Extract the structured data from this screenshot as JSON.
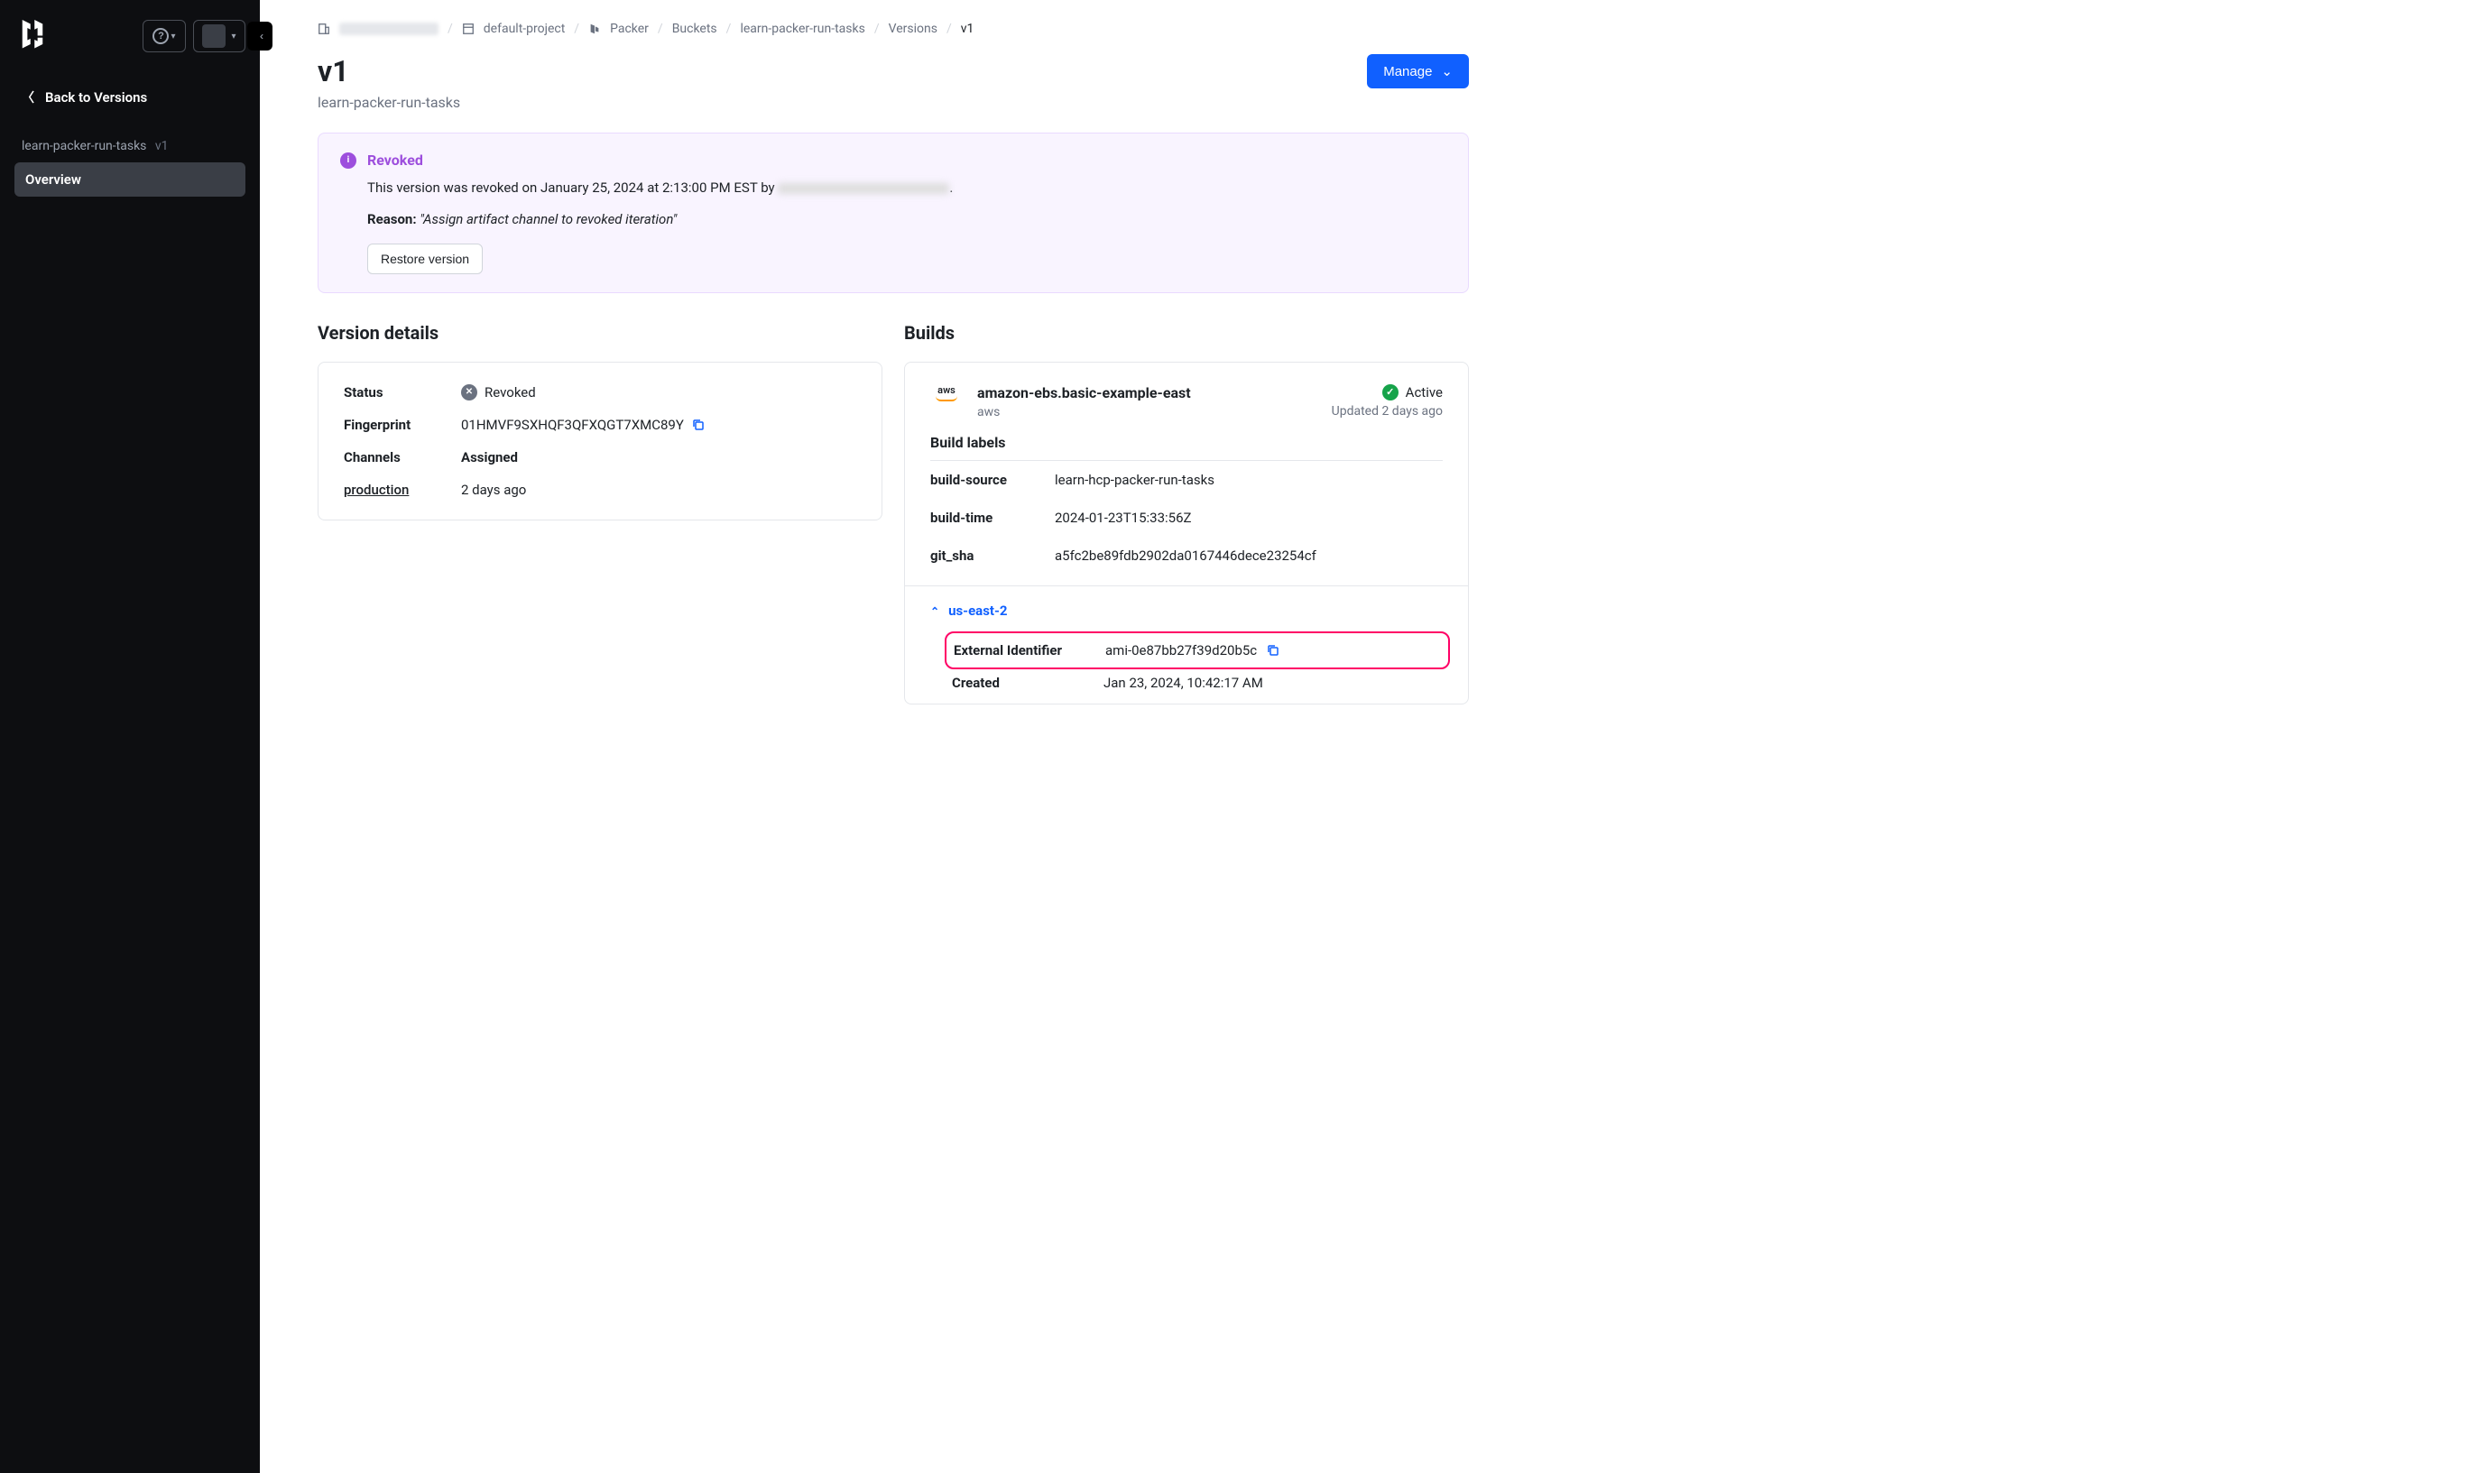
{
  "sidebar": {
    "back_label": "Back to Versions",
    "context_name": "learn-packer-run-tasks",
    "context_version": "v1",
    "items": [
      {
        "label": "Overview",
        "active": true
      }
    ]
  },
  "breadcrumb": {
    "org_redacted": true,
    "project": "default-project",
    "service": "Packer",
    "buckets": "Buckets",
    "bucket": "learn-packer-run-tasks",
    "versions": "Versions",
    "current": "v1"
  },
  "header": {
    "title": "v1",
    "subtitle": "learn-packer-run-tasks",
    "manage_label": "Manage"
  },
  "alert": {
    "title": "Revoked",
    "text_prefix": "This version was revoked on January 25, 2024 at 2:13:00 PM EST by ",
    "text_suffix": ".",
    "reason_label": "Reason:",
    "reason_text": "\"Assign artifact channel to revoked iteration\"",
    "restore_label": "Restore version"
  },
  "details": {
    "section_title": "Version details",
    "rows": {
      "status_label": "Status",
      "status_value": "Revoked",
      "fingerprint_label": "Fingerprint",
      "fingerprint_value": "01HMVF9SXHQF3QFXQGT7XMC89Y",
      "channels_label": "Channels",
      "channels_value": "Assigned",
      "production_label": "production",
      "production_value": "2 days ago"
    }
  },
  "builds": {
    "section_title": "Builds",
    "name": "amazon-ebs.basic-example-east",
    "provider": "aws",
    "status": "Active",
    "updated": "Updated 2 days ago",
    "labels_title": "Build labels",
    "labels": [
      {
        "key": "build-source",
        "value": "learn-hcp-packer-run-tasks"
      },
      {
        "key": "build-time",
        "value": "2024-01-23T15:33:56Z"
      },
      {
        "key": "git_sha",
        "value": "a5fc2be89fdb2902da0167446dece23254cf"
      }
    ],
    "region": {
      "name": "us-east-2",
      "external_id_label": "External Identifier",
      "external_id_value": "ami-0e87bb27f39d20b5c",
      "created_label": "Created",
      "created_value": "Jan 23, 2024, 10:42:17 AM"
    }
  }
}
